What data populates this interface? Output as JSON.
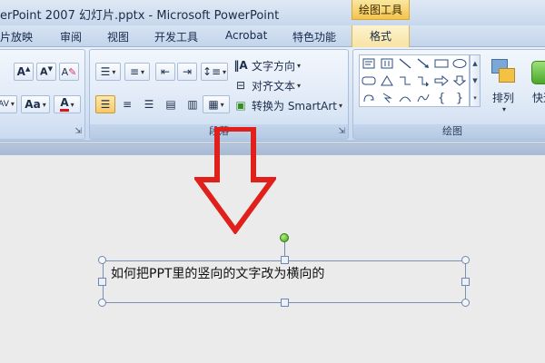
{
  "window": {
    "title": "erPoint 2007 幻灯片.pptx - Microsoft PowerPoint",
    "context_tool": "绘图工具"
  },
  "tabs": [
    {
      "label": "片放映"
    },
    {
      "label": "审阅"
    },
    {
      "label": "视图"
    },
    {
      "label": "开发工具"
    },
    {
      "label": "Acrobat"
    },
    {
      "label": "特色功能"
    },
    {
      "label": "格式"
    }
  ],
  "ribbon": {
    "paragraph": {
      "label": "段落",
      "text_direction": "文字方向",
      "align_text": "对齐文本",
      "smartart": "转换为 SmartArt"
    },
    "drawing": {
      "label": "绘图",
      "arrange": "排列",
      "quick_styles": "快速"
    },
    "font": {
      "font_size_btn": "Aa"
    }
  },
  "slide": {
    "textbox_text": "如何把PPT里的竖向的文字改为横向的"
  },
  "colors": {
    "arrow_red": "#e0201b",
    "accent_yellow": "#f8c867",
    "font_color_red": "#d8171b"
  }
}
